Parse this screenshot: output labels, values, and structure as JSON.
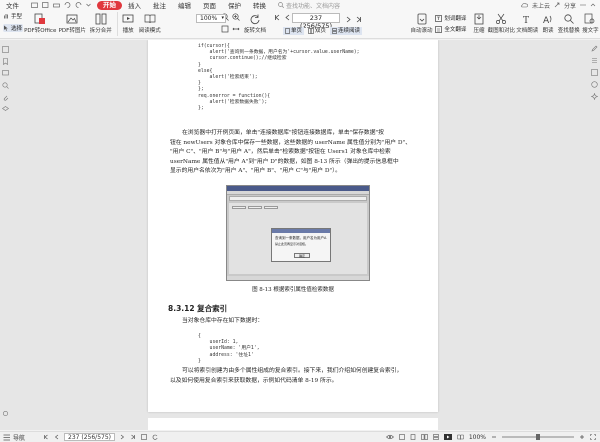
{
  "menu": {
    "items": [
      "文件",
      "",
      "",
      "",
      "",
      "",
      "",
      "开始",
      "插入",
      "批注",
      "编辑",
      "页面",
      "保护",
      "转换"
    ],
    "active_index": 7,
    "search_text": "查找功能、文档内容",
    "user": "未上云",
    "share": "分享"
  },
  "toolbar": {
    "hand": "手型",
    "select": "选择",
    "pdf_to_office": "PDF转Office",
    "pdf_to_image": "PDF转图片",
    "split_merge": "拆分合并",
    "play": "播放",
    "read_mode": "阅读模式",
    "zoom": "100%",
    "rotate": "旋转文档",
    "page_indicator": "237 (256/575)",
    "single_page": "单页",
    "double_page": "双页",
    "continuous": "连续阅读",
    "auto_scroll": "自动滚动",
    "translate": "划词翻译",
    "full_translate": "全文翻译",
    "compress": "压缩",
    "screenshot_compare": "截图和对比",
    "read_aloud": "文档朗读",
    "read": "朗读",
    "search_replace": "查找替换",
    "search_text": "搜文字"
  },
  "document": {
    "code1": "if(cursor){\n    alert('查询到一条数据，用户名为'+cursor.value.userName);\n    cursor.continue();//继续检索\n}\nelse{\n    alert('检索结束');\n}\n};\nreq.onerror = function(){\n    alert('检索数据失败');\n};",
    "para1_lines": [
      "在浏览器中打开例页面，单击\"连接数据库\"按钮连接数据库，单击\"保存数据\"按",
      "钮在 newUsers 对象仓库中保存一些数据，这些数据的 userName 属性值分别为\"用户 D\"、",
      "\"用户 C\"、\"用户 B\"与\"用户 A\"，然后单击\"检索数据\"按钮在 Users1 对象仓库中检索",
      "userName 属性值从\"用户 A\"到\"用户 D\"的数据，如图 8-13 所示（弹出的提示信息框中",
      "显示的用户名依次为\"用户 A\"、\"用户 B\"、\"用户 C\"与\"用户 D\"）。"
    ],
    "dialog_message": "查询到一条数据，用户名为用户A",
    "dialog_check": "禁止此页再显示对话框。",
    "dialog_ok": "确定",
    "caption": "图 8-13    根据索引属性值检索数据",
    "heading": "8.3.12    复合索引",
    "para2": "当对象仓库中存在如下数据时：",
    "code2": "{\n    userId: 1,\n    userName: '用户1',\n    address: '住址1'\n}",
    "para3_lines": [
      "可以将索引创建为由多个属性组成的复合索引。接下来，我们介绍如何创建复合索引，",
      "以及如何使用复合索引来获取数据，示例如代码清单 8-19 所示。"
    ]
  },
  "status": {
    "nav_label": "导航",
    "page": "237 (256/575)",
    "zoom": "100%"
  }
}
